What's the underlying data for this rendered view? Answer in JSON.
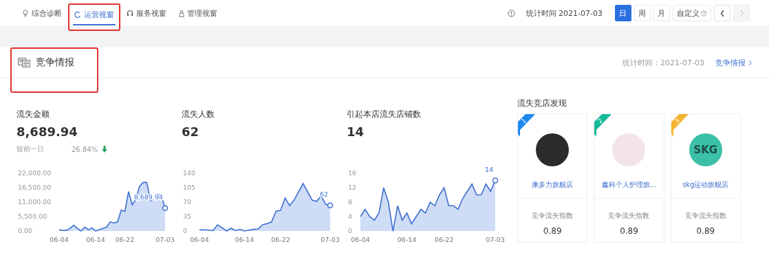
{
  "nav": {
    "tabs": [
      {
        "kind": "diagnosis",
        "label": "综合诊断",
        "selected": false,
        "highlighted": false
      },
      {
        "kind": "operations",
        "label": "运营视窗",
        "selected": true,
        "highlighted": true
      },
      {
        "kind": "service",
        "label": "服务视窗",
        "selected": false,
        "highlighted": false
      },
      {
        "kind": "management",
        "label": "管理视窗",
        "selected": false,
        "highlighted": false
      }
    ],
    "stat_time": "统计时间 2021-07-03",
    "periods": [
      {
        "label": "日",
        "selected": true
      },
      {
        "label": "周",
        "selected": false
      },
      {
        "label": "月",
        "selected": false
      },
      {
        "label": "自定义",
        "selected": false
      }
    ],
    "arrows": [
      {
        "kind": "prev",
        "disabled": false
      },
      {
        "kind": "next",
        "disabled": true
      }
    ]
  },
  "section": {
    "title": "竞争情报",
    "highlighted": true,
    "stat_time": "统计时间：2021-07-03",
    "link": "竞争情报"
  },
  "metrics": [
    {
      "label": "流失金额",
      "value": "8,689.94",
      "compare_label": "较前一日",
      "change": "26.84%",
      "falling": true,
      "chart_data": {
        "type": "area",
        "categories": [
          "06-04",
          null,
          null,
          null,
          null,
          null,
          null,
          null,
          null,
          null,
          "06-14",
          null,
          null,
          null,
          null,
          null,
          null,
          null,
          "06-22",
          null,
          null,
          null,
          null,
          null,
          null,
          null,
          null,
          null,
          null,
          "07-03"
        ],
        "series": [
          {
            "color": "#cfdcf6",
            "values": [
              500,
              200,
              300,
              1000,
              2200,
              1000,
              0,
              1500,
              500,
              1200,
              0,
              500,
              1000,
              1500,
              3500,
              3000,
              3500,
              8000,
              7500,
              15000,
              10000,
              12000,
              17000,
              18500,
              18500,
              11500,
              12500,
              14000,
              13500,
              8690
            ]
          }
        ],
        "ylim": [
          0,
          22000
        ],
        "yticks": [
          {
            "value": 0,
            "label": "0.00"
          },
          {
            "value": 5500,
            "label": "5,500.00"
          },
          {
            "value": 11000,
            "label": "11,000.00"
          },
          {
            "value": 16500,
            "label": "16,500.00"
          },
          {
            "value": 22000,
            "label": "22,000.00"
          }
        ],
        "annotations": [
          {
            "x": "07-03",
            "y": 8690,
            "text": "8,689.94"
          }
        ]
      }
    },
    {
      "label": "流失人数",
      "value": "62",
      "chart_data": {
        "type": "area",
        "categories": [
          "06-04",
          null,
          null,
          null,
          null,
          null,
          null,
          null,
          null,
          null,
          "06-14",
          null,
          null,
          null,
          null,
          null,
          null,
          null,
          "06-22",
          null,
          null,
          null,
          null,
          null,
          null,
          null,
          null,
          null,
          null,
          "07-03"
        ],
        "series": [
          {
            "color": "#cfdcf6",
            "values": [
              3,
              3,
              2,
              1,
              15,
              8,
              0,
              7,
              1,
              4,
              0,
              2,
              4,
              5,
              15,
              18,
              22,
              48,
              50,
              80,
              62,
              75,
              95,
              115,
              95,
              75,
              72,
              85,
              65,
              62
            ]
          }
        ],
        "ylim": [
          0,
          140
        ],
        "yticks": [
          0,
          35,
          70,
          105,
          140
        ],
        "annotations": [
          {
            "x": "07-03",
            "y": 62,
            "text": "62"
          }
        ]
      }
    },
    {
      "label": "引起本店流失店铺数",
      "value": "14",
      "chart_data": {
        "type": "area",
        "categories": [
          "06-04",
          null,
          null,
          null,
          null,
          null,
          null,
          null,
          null,
          null,
          "06-14",
          null,
          null,
          null,
          null,
          null,
          null,
          null,
          "06-22",
          null,
          null,
          null,
          null,
          null,
          null,
          null,
          null,
          null,
          null,
          "07-03"
        ],
        "series": [
          {
            "color": "#cfdcf6",
            "values": [
              4,
              6,
              4,
              3,
              5,
              12,
              8,
              0,
              7,
              3,
              5,
              2,
              4,
              6,
              5,
              8,
              7,
              10,
              12,
              7,
              7,
              6,
              9,
              11,
              13,
              10,
              10,
              13,
              11,
              14
            ]
          }
        ],
        "ylim": [
          0,
          16
        ],
        "yticks": [
          0,
          4,
          8,
          12,
          16
        ],
        "annotations": [
          {
            "x": "07-03",
            "y": 14,
            "text": "14"
          }
        ]
      }
    }
  ],
  "stores": {
    "title": "流失竞店发现",
    "items": [
      {
        "rank": "1",
        "color": "#1e88f0",
        "logo": {
          "kind": "dark"
        },
        "name": "康多力旗舰店",
        "index_label": "竞争流失指数",
        "index_value": "0.89"
      },
      {
        "rank": "2",
        "color": "#16b89a",
        "logo": {
          "kind": "pale"
        },
        "name": "鑫科个人护理旗...",
        "index_label": "竞争流失指数",
        "index_value": "0.89"
      },
      {
        "rank": "3",
        "color": "#f5b431",
        "logo": {
          "kind": "text",
          "text": "SKG"
        },
        "name": "skg运动旗舰店",
        "index_label": "竞争流失指数",
        "index_value": "0.89"
      }
    ]
  }
}
